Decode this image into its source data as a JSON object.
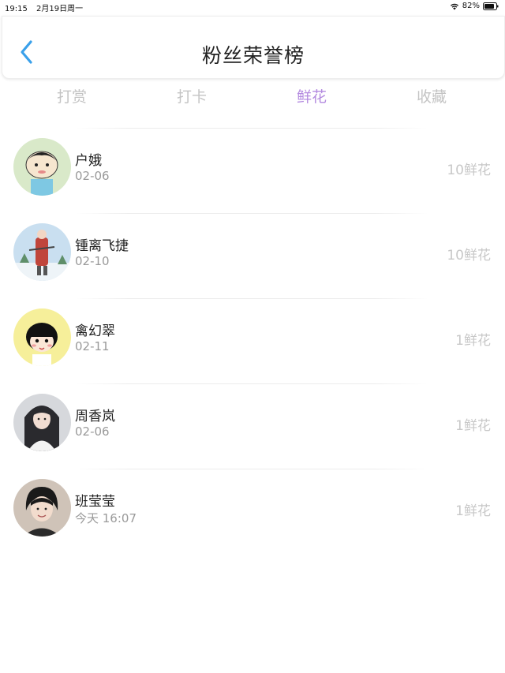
{
  "status_bar": {
    "time": "19:15",
    "date": "2月19日周一",
    "battery": "82%"
  },
  "header": {
    "title": "粉丝荣誉榜",
    "back_icon": "chevron-left-icon"
  },
  "tabs": [
    {
      "label": "打赏",
      "active": false
    },
    {
      "label": "打卡",
      "active": false
    },
    {
      "label": "鲜花",
      "active": true
    },
    {
      "label": "收藏",
      "active": false
    }
  ],
  "colors": {
    "accent": "#b48be0",
    "back_icon": "#3aa0ea",
    "muted_text": "#9a9a9a",
    "count_text": "#c8c8c8"
  },
  "fans": [
    {
      "name": "户娥",
      "date": "02-06",
      "count": "10鲜花",
      "avatar": "cartoon-boy-avatar"
    },
    {
      "name": "锺离飞捷",
      "date": "02-10",
      "count": "10鲜花",
      "avatar": "snow-figure-avatar"
    },
    {
      "name": "禽幻翠",
      "date": "02-11",
      "count": "1鲜花",
      "avatar": "cartoon-girl-avatar"
    },
    {
      "name": "周香岚",
      "date": "02-06",
      "count": "1鲜花",
      "avatar": "girl-photo-avatar"
    },
    {
      "name": "班莹莹",
      "date": "今天 16:07",
      "count": "1鲜花",
      "avatar": "boy-photo-avatar"
    }
  ]
}
